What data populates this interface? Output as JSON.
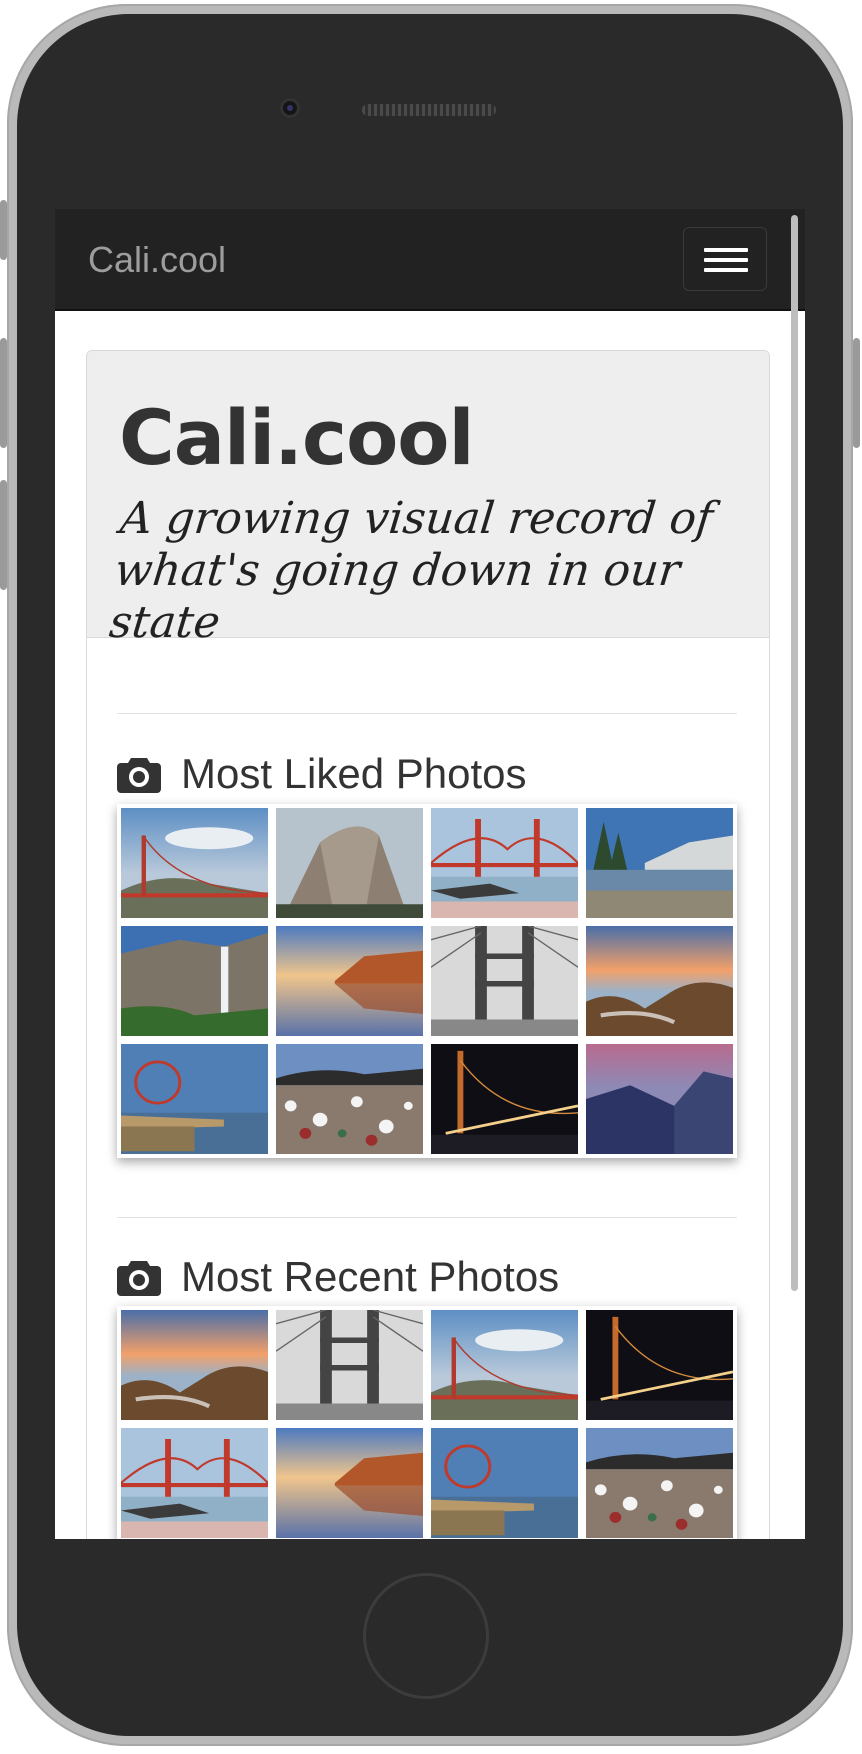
{
  "navbar": {
    "brand": "Cali.cool"
  },
  "jumbotron": {
    "title": "Cali.cool",
    "subtitle": "A growing visual record of what's going down in our state"
  },
  "sections": {
    "most_liked": {
      "heading": "Most Liked Photos",
      "icon": "camera-icon",
      "photos": [
        "golden-gate-fog",
        "half-dome",
        "golden-gate-beach",
        "tenaya-lake",
        "yosemite-falls",
        "pismo-sunset-reflection",
        "golden-gate-bw",
        "rocky-coast-sunset",
        "santa-monica-pier",
        "glass-beach",
        "golden-gate-night",
        "yosemite-valley-dusk"
      ]
    },
    "most_recent": {
      "heading": "Most Recent Photos",
      "icon": "camera-icon",
      "photos": [
        "rocky-coast-sunset",
        "golden-gate-bw",
        "golden-gate-fog",
        "golden-gate-night",
        "golden-gate-beach",
        "pismo-sunset-reflection",
        "santa-monica-pier",
        "glass-beach"
      ]
    }
  },
  "colors": {
    "navbar": "#222222",
    "brand": "#9d9d9d",
    "jumbotron": "#eeeeee",
    "text": "#333333"
  }
}
